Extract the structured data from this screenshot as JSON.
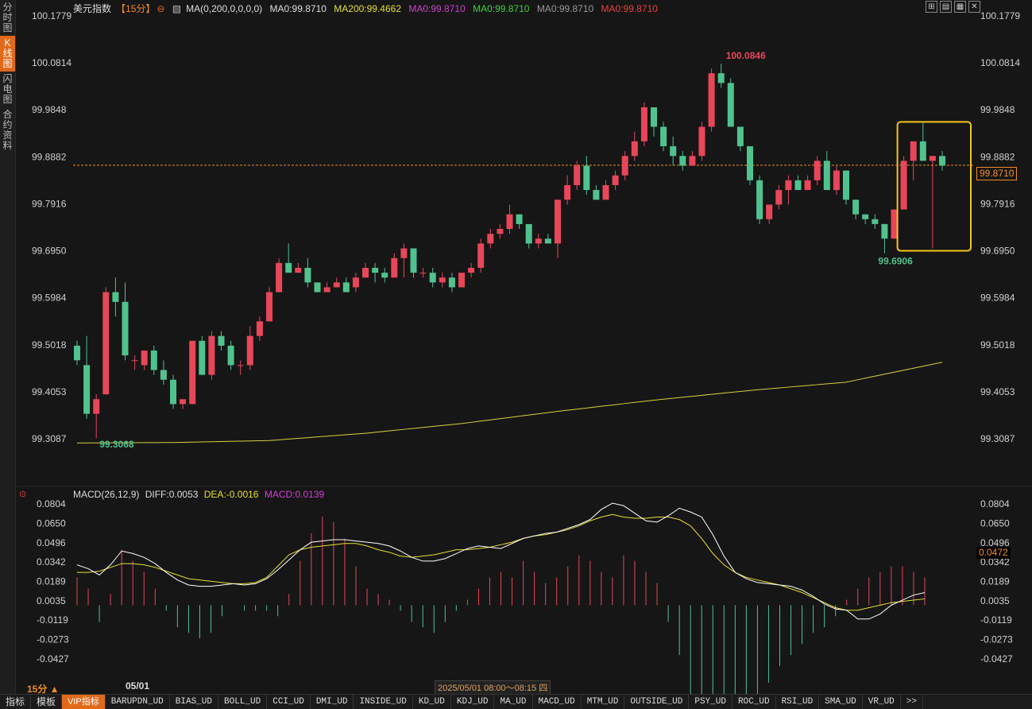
{
  "left_tabs": [
    "分时图",
    "K线图",
    "闪电图",
    "合约资料"
  ],
  "title": {
    "name": "美元指数",
    "period": "【15分】",
    "ma_params": "MA(0,200,0,0,0,0)",
    "ma0_a": "MA0:99.8710",
    "ma200": "MA200:99.4662",
    "ma0_b": "MA0:99.8710",
    "ma0_c": "MA0:99.8710",
    "ma0_d": "MA0:99.8710",
    "ma0_e": "MA0:99.8710"
  },
  "macd_title": {
    "params": "MACD(26,12,9)",
    "diff": "DIFF:0.0053",
    "dea": "DEA:-0.0016",
    "macd": "MACD:0.0139"
  },
  "window_controls": [
    "⊞",
    "▤",
    "▦",
    "✕"
  ],
  "colors": {
    "up": "#e8475a",
    "down": "#4fc28e",
    "ma200": "#d8d040",
    "diff": "#ffffff",
    "dea": "#e6df30",
    "accent": "#f08c28"
  },
  "current_price_label": "99.8710",
  "macd_current_label": "0.0472",
  "period_label": "15分 ▲",
  "date_label": "05/01",
  "crosshair_time": "2025/05/01 08:00～08:15 四",
  "bottom_tabs": [
    "指标",
    "模板",
    "VIP指标",
    "BARUPDN_UD",
    "BIAS_UD",
    "BOLL_UD",
    "CCI_UD",
    "DMI_UD",
    "INSIDE_UD",
    "KD_UD",
    "KDJ_UD",
    "MA_UD",
    "MACD_UD",
    "MTM_UD",
    "OUTSIDE_UD",
    "PSY_UD",
    "ROC_UD",
    "RSI_UD",
    "SMA_UD",
    "VR_UD",
    ">>"
  ],
  "chart_data": [
    {
      "type": "candlestick",
      "title": "美元指数 15分",
      "y_ticks": [
        "100.1779",
        "100.0814",
        "99.9848",
        "99.8882",
        "99.7916",
        "99.6950",
        "99.5984",
        "99.5018",
        "99.4053",
        "99.3087"
      ],
      "high_label": "100.0846",
      "low_label_1": "99.3068",
      "low_label_2": "99.6906",
      "current": 99.871,
      "candles": [
        [
          99.5,
          99.47,
          99.51,
          99.46
        ],
        [
          99.46,
          99.36,
          99.52,
          99.35
        ],
        [
          99.36,
          99.39,
          99.4,
          99.31
        ],
        [
          99.4,
          99.61,
          99.62,
          99.4
        ],
        [
          99.61,
          99.59,
          99.64,
          99.56
        ],
        [
          99.59,
          99.48,
          99.63,
          99.47
        ],
        [
          99.47,
          99.47,
          99.48,
          99.45
        ],
        [
          99.46,
          99.49,
          99.49,
          99.45
        ],
        [
          99.49,
          99.45,
          99.5,
          99.44
        ],
        [
          99.45,
          99.43,
          99.47,
          99.42
        ],
        [
          99.43,
          99.38,
          99.44,
          99.37
        ],
        [
          99.38,
          99.39,
          99.39,
          99.37
        ],
        [
          99.38,
          99.51,
          99.51,
          99.38
        ],
        [
          99.51,
          99.44,
          99.52,
          99.44
        ],
        [
          99.44,
          99.52,
          99.53,
          99.43
        ],
        [
          99.52,
          99.5,
          99.53,
          99.49
        ],
        [
          99.5,
          99.46,
          99.51,
          99.45
        ],
        [
          99.46,
          99.46,
          99.47,
          99.44
        ],
        [
          99.46,
          99.52,
          99.54,
          99.45
        ],
        [
          99.52,
          99.55,
          99.56,
          99.51
        ],
        [
          99.55,
          99.61,
          99.62,
          99.55
        ],
        [
          99.61,
          99.67,
          99.68,
          99.61
        ],
        [
          99.67,
          99.65,
          99.71,
          99.65
        ],
        [
          99.65,
          99.66,
          99.67,
          99.65
        ],
        [
          99.66,
          99.63,
          99.68,
          99.62
        ],
        [
          99.63,
          99.61,
          99.63,
          99.61
        ],
        [
          99.61,
          99.62,
          99.63,
          99.61
        ],
        [
          99.62,
          99.63,
          99.64,
          99.62
        ],
        [
          99.63,
          99.61,
          99.64,
          99.61
        ],
        [
          99.62,
          99.64,
          99.65,
          99.61
        ],
        [
          99.64,
          99.66,
          99.67,
          99.64
        ],
        [
          99.66,
          99.65,
          99.67,
          99.63
        ],
        [
          99.65,
          99.64,
          99.66,
          99.63
        ],
        [
          99.64,
          99.68,
          99.69,
          99.64
        ],
        [
          99.68,
          99.7,
          99.71,
          99.64
        ],
        [
          99.7,
          99.65,
          99.7,
          99.64
        ],
        [
          99.65,
          99.65,
          99.66,
          99.64
        ],
        [
          99.65,
          99.63,
          99.66,
          99.62
        ],
        [
          99.63,
          99.64,
          99.65,
          99.62
        ],
        [
          99.64,
          99.62,
          99.65,
          99.61
        ],
        [
          99.62,
          99.65,
          99.65,
          99.62
        ],
        [
          99.65,
          99.66,
          99.67,
          99.64
        ],
        [
          99.66,
          99.71,
          99.72,
          99.65
        ],
        [
          99.71,
          99.73,
          99.74,
          99.7
        ],
        [
          99.73,
          99.74,
          99.75,
          99.72
        ],
        [
          99.74,
          99.77,
          99.79,
          99.73
        ],
        [
          99.77,
          99.75,
          99.77,
          99.74
        ],
        [
          99.75,
          99.71,
          99.75,
          99.7
        ],
        [
          99.71,
          99.72,
          99.73,
          99.7
        ],
        [
          99.72,
          99.71,
          99.73,
          99.71
        ],
        [
          99.71,
          99.8,
          99.8,
          99.68
        ],
        [
          99.8,
          99.83,
          99.85,
          99.79
        ],
        [
          99.83,
          99.87,
          99.88,
          99.82
        ],
        [
          99.87,
          99.82,
          99.89,
          99.81
        ],
        [
          99.82,
          99.8,
          99.83,
          99.8
        ],
        [
          99.8,
          99.83,
          99.84,
          99.8
        ],
        [
          99.83,
          99.85,
          99.86,
          99.82
        ],
        [
          99.85,
          99.89,
          99.9,
          99.84
        ],
        [
          99.89,
          99.92,
          99.94,
          99.88
        ],
        [
          99.92,
          99.99,
          100.0,
          99.91
        ],
        [
          99.99,
          99.95,
          99.99,
          99.93
        ],
        [
          99.95,
          99.91,
          99.96,
          99.9
        ],
        [
          99.91,
          99.89,
          99.93,
          99.87
        ],
        [
          99.89,
          99.87,
          99.9,
          99.86
        ],
        [
          99.87,
          99.89,
          99.9,
          99.87
        ],
        [
          99.89,
          99.95,
          99.96,
          99.88
        ],
        [
          99.95,
          100.06,
          100.07,
          99.94
        ],
        [
          100.06,
          100.04,
          100.08,
          100.03
        ],
        [
          100.04,
          99.95,
          100.05,
          99.95
        ],
        [
          99.95,
          99.91,
          99.95,
          99.9
        ],
        [
          99.91,
          99.84,
          99.91,
          99.83
        ],
        [
          99.84,
          99.76,
          99.85,
          99.75
        ],
        [
          99.76,
          99.79,
          99.79,
          99.75
        ],
        [
          99.79,
          99.82,
          99.83,
          99.78
        ],
        [
          99.82,
          99.84,
          99.85,
          99.79
        ],
        [
          99.84,
          99.82,
          99.85,
          99.82
        ],
        [
          99.82,
          99.84,
          99.85,
          99.82
        ],
        [
          99.84,
          99.88,
          99.89,
          99.83
        ],
        [
          99.88,
          99.82,
          99.9,
          99.82
        ],
        [
          99.82,
          99.86,
          99.87,
          99.81
        ],
        [
          99.86,
          99.8,
          99.86,
          99.79
        ],
        [
          99.8,
          99.77,
          99.8,
          99.76
        ],
        [
          99.77,
          99.76,
          99.77,
          99.75
        ],
        [
          99.76,
          99.75,
          99.77,
          99.74
        ],
        [
          99.75,
          99.72,
          99.75,
          99.69
        ],
        [
          99.72,
          99.78,
          99.78,
          99.72
        ],
        [
          99.78,
          99.88,
          99.89,
          99.78
        ],
        [
          99.88,
          99.92,
          99.92,
          99.84
        ],
        [
          99.92,
          99.88,
          99.96,
          99.88
        ],
        [
          99.88,
          99.89,
          99.89,
          99.7
        ],
        [
          99.89,
          99.87,
          99.9,
          99.86
        ]
      ],
      "ma200": [
        [
          0,
          99.3
        ],
        [
          10,
          99.301
        ],
        [
          20,
          99.305
        ],
        [
          30,
          99.32
        ],
        [
          40,
          99.34
        ],
        [
          50,
          99.365
        ],
        [
          60,
          99.388
        ],
        [
          70,
          99.408
        ],
        [
          80,
          99.425
        ],
        [
          90,
          99.466
        ]
      ]
    },
    {
      "type": "line",
      "title": "MACD(26,12,9)",
      "y_ticks": [
        "0.0804",
        "0.0650",
        "0.0496",
        "0.0342",
        "0.0189",
        "0.0035",
        "-0.0119",
        "-0.0273",
        "-0.0427"
      ],
      "series": [
        {
          "name": "DIFF",
          "values": [
            0.032,
            0.029,
            0.024,
            0.032,
            0.043,
            0.041,
            0.038,
            0.033,
            0.026,
            0.02,
            0.016,
            0.015,
            0.015,
            0.016,
            0.017,
            0.016,
            0.017,
            0.021,
            0.028,
            0.036,
            0.044,
            0.05,
            0.051,
            0.052,
            0.052,
            0.051,
            0.05,
            0.049,
            0.047,
            0.043,
            0.038,
            0.035,
            0.035,
            0.037,
            0.041,
            0.045,
            0.047,
            0.046,
            0.045,
            0.049,
            0.053,
            0.055,
            0.057,
            0.058,
            0.061,
            0.064,
            0.068,
            0.076,
            0.081,
            0.079,
            0.073,
            0.067,
            0.066,
            0.071,
            0.077,
            0.074,
            0.07,
            0.056,
            0.039,
            0.026,
            0.021,
            0.018,
            0.017,
            0.016,
            0.015,
            0.012,
            0.007,
            0.001,
            -0.003,
            -0.004,
            -0.011,
            -0.011,
            -0.007,
            0.0,
            0.004,
            0.008,
            0.01
          ]
        },
        {
          "name": "DEA",
          "values": [
            0.026,
            0.026,
            0.027,
            0.03,
            0.033,
            0.033,
            0.032,
            0.03,
            0.027,
            0.024,
            0.021,
            0.02,
            0.019,
            0.018,
            0.017,
            0.017,
            0.018,
            0.022,
            0.031,
            0.04,
            0.044,
            0.046,
            0.047,
            0.048,
            0.049,
            0.049,
            0.047,
            0.044,
            0.042,
            0.039,
            0.038,
            0.039,
            0.04,
            0.042,
            0.044,
            0.044,
            0.045,
            0.046,
            0.048,
            0.05,
            0.053,
            0.055,
            0.056,
            0.058,
            0.06,
            0.063,
            0.067,
            0.07,
            0.072,
            0.07,
            0.069,
            0.069,
            0.07,
            0.07,
            0.068,
            0.063,
            0.053,
            0.041,
            0.032,
            0.026,
            0.022,
            0.02,
            0.018,
            0.016,
            0.013,
            0.01,
            0.006,
            0.002,
            -0.002,
            -0.004,
            -0.004,
            -0.002,
            0.0,
            0.002,
            0.003,
            0.004,
            0.005
          ]
        },
        {
          "name": "MACD",
          "values": [
            0.01,
            0.006,
            -0.006,
            0.004,
            0.02,
            0.016,
            0.012,
            0.006,
            -0.002,
            -0.008,
            -0.01,
            -0.012,
            -0.01,
            -0.004,
            0.0,
            -0.002,
            -0.002,
            -0.002,
            -0.004,
            0.004,
            0.016,
            0.026,
            0.032,
            0.03,
            0.024,
            0.014,
            0.006,
            0.004,
            0.002,
            -0.002,
            -0.006,
            -0.008,
            -0.01,
            -0.006,
            -0.002,
            0.002,
            0.006,
            0.01,
            0.012,
            0.01,
            0.016,
            0.012,
            0.008,
            0.01,
            0.014,
            0.018,
            0.016,
            0.012,
            0.01,
            0.018,
            0.016,
            0.012,
            0.008,
            -0.006,
            -0.018,
            -0.034,
            -0.046,
            -0.05,
            -0.048,
            -0.044,
            -0.04,
            -0.034,
            -0.028,
            -0.022,
            -0.018,
            -0.014,
            -0.01,
            -0.008,
            -0.004,
            0.002,
            0.006,
            0.01,
            0.012,
            0.014,
            0.014,
            0.012,
            0.01
          ]
        }
      ]
    }
  ]
}
